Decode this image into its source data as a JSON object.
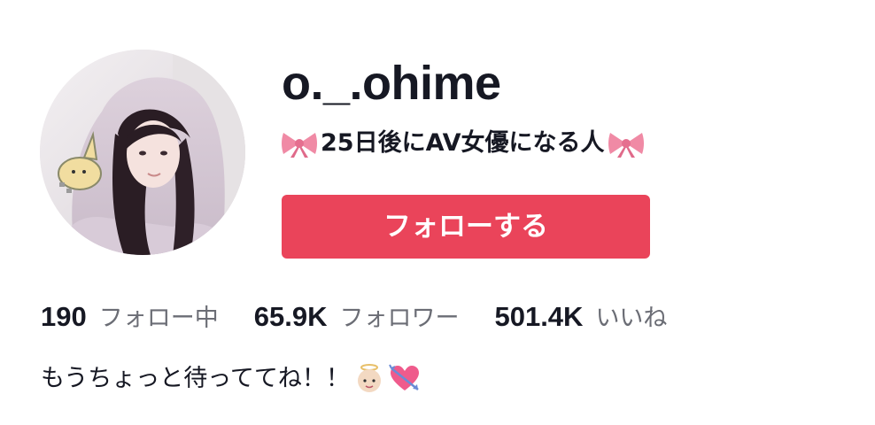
{
  "profile": {
    "username": "o._.ohime",
    "nickname_text": "25日後にAV女優になる人",
    "nickname_emoji_left": "ribbon-icon",
    "nickname_emoji_right": "ribbon-icon",
    "avatar_alt": "profile-photo"
  },
  "actions": {
    "follow_label": "フォローする",
    "follow_color": "#ea445a"
  },
  "stats": [
    {
      "value": "190",
      "label": "フォロー中"
    },
    {
      "value": "65.9K",
      "label": "フォロワー"
    },
    {
      "value": "501.4K",
      "label": "いいね"
    }
  ],
  "bio": {
    "text": "もうちょっと待っててね！！",
    "emojis": [
      "baby-angel-icon",
      "heart-with-arrow-icon"
    ]
  }
}
